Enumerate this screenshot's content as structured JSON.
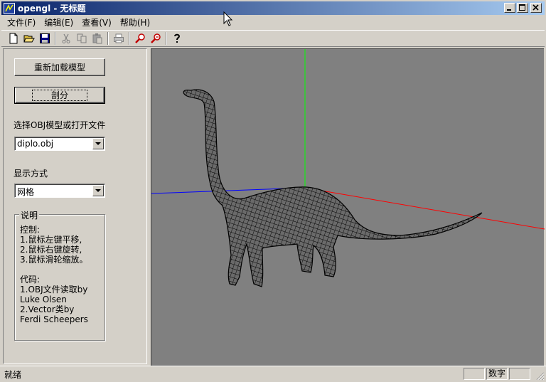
{
  "window": {
    "title": "opengl - 无标题"
  },
  "menu": {
    "items": [
      "文件(F)",
      "编辑(E)",
      "查看(V)",
      "帮助(H)"
    ]
  },
  "toolbar": {
    "icons": [
      "new-file-icon",
      "open-folder-icon",
      "save-icon",
      "cut-icon",
      "copy-icon",
      "paste-icon",
      "print-icon",
      "zoom-in-icon",
      "zoom-out-icon",
      "help-icon"
    ]
  },
  "panel": {
    "reload_button": "重新加载模型",
    "split_button": "剖分",
    "model_label": "选择OBJ模型或打开文件",
    "model_value": "diplo.obj",
    "display_label": "显示方式",
    "display_value": "网格",
    "info_title": "说明",
    "info_text": "控制:\n1.鼠标左键平移,\n2.鼠标右键旋转,\n3.鼠标滑轮缩放。\n\n代码:\n1.OBJ文件读取by\nLuke Olsen\n2.Vector类by\nFerdi Scheepers"
  },
  "viewport": {
    "background": "#808080",
    "axis_colors": {
      "x": "#ff0000",
      "y": "#00ff00",
      "z": "#0000ff"
    },
    "mesh_color": "#000000"
  },
  "status": {
    "text": "就绪",
    "num_lock": "数字"
  }
}
